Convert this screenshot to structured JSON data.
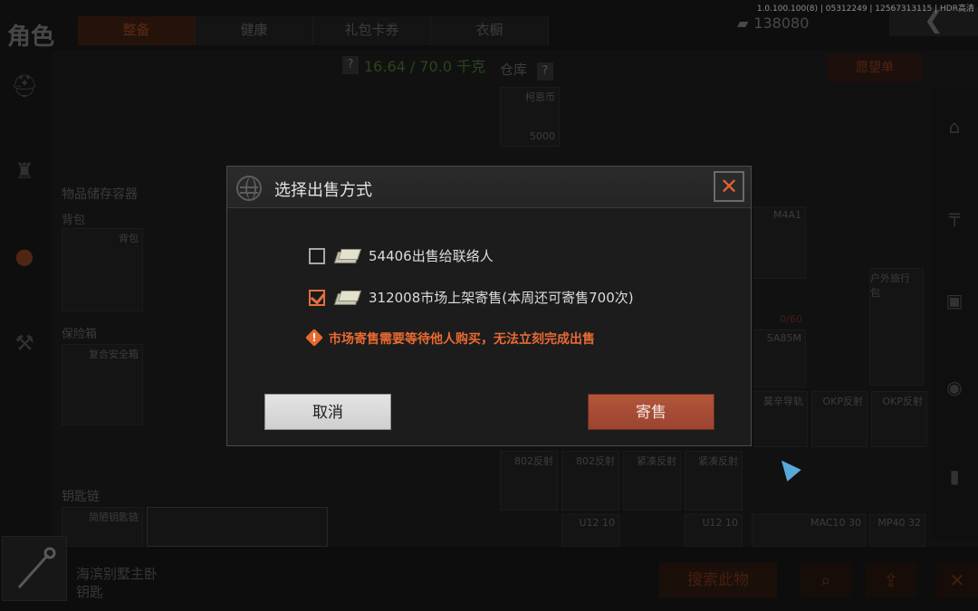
{
  "app": {
    "title": "角色",
    "version": "1.0.100.100(8) | 05312249 | 12567313115 | HDR高清",
    "currency": "138080"
  },
  "tabs": [
    {
      "label": "整备",
      "active": true
    },
    {
      "label": "健康"
    },
    {
      "label": "礼包卡券"
    },
    {
      "label": "衣橱"
    }
  ],
  "inventory": {
    "weight": "16.64 / 70.0 千克",
    "help": "?",
    "storage_label": "物品储存容器",
    "backpack_label": "背包",
    "backpack_slot": "背包",
    "safe_label": "保险箱",
    "safe_slot": "复合安全箱",
    "keychain_label": "钥匙链",
    "keychain_slot": "简陋钥匙链"
  },
  "warehouse": {
    "label": "仓库",
    "help": "?",
    "wishlist": "愿望单",
    "items": [
      {
        "name": "柯恩币",
        "count": "5000"
      },
      {
        "name": "M4A1"
      },
      {
        "name": "户外旅行包"
      },
      {
        "name": "SA85M"
      },
      {
        "name": "0/60"
      },
      {
        "name": "莫辛导轨"
      },
      {
        "name": "OKP反射"
      },
      {
        "name": "OKP反射"
      },
      {
        "name": "802反射"
      },
      {
        "name": "802反射"
      },
      {
        "name": "紧凑反射"
      },
      {
        "name": "紧凑反射"
      },
      {
        "name": "U12 10"
      },
      {
        "name": "U12 10"
      },
      {
        "name": "MAC10 30"
      },
      {
        "name": "MP40 32"
      }
    ]
  },
  "bottom": {
    "item_name_line1": "海滨别墅主卧",
    "item_name_line2": "钥匙",
    "search_label": "搜索此物"
  },
  "dialog": {
    "title": "选择出售方式",
    "close": "✕",
    "options": [
      {
        "text": "54406出售给联络人",
        "checked": false
      },
      {
        "text": "312008市场上架寄售(本周还可寄售700次)",
        "checked": true
      }
    ],
    "warning": "市场寄售需要等待他人购买，无法立刻完成出售",
    "cancel_label": "取消",
    "confirm_label": "寄售"
  },
  "colors": {
    "accent": "#e0703e",
    "confirm_button": "#a24a34",
    "warning": "#e86a33"
  }
}
